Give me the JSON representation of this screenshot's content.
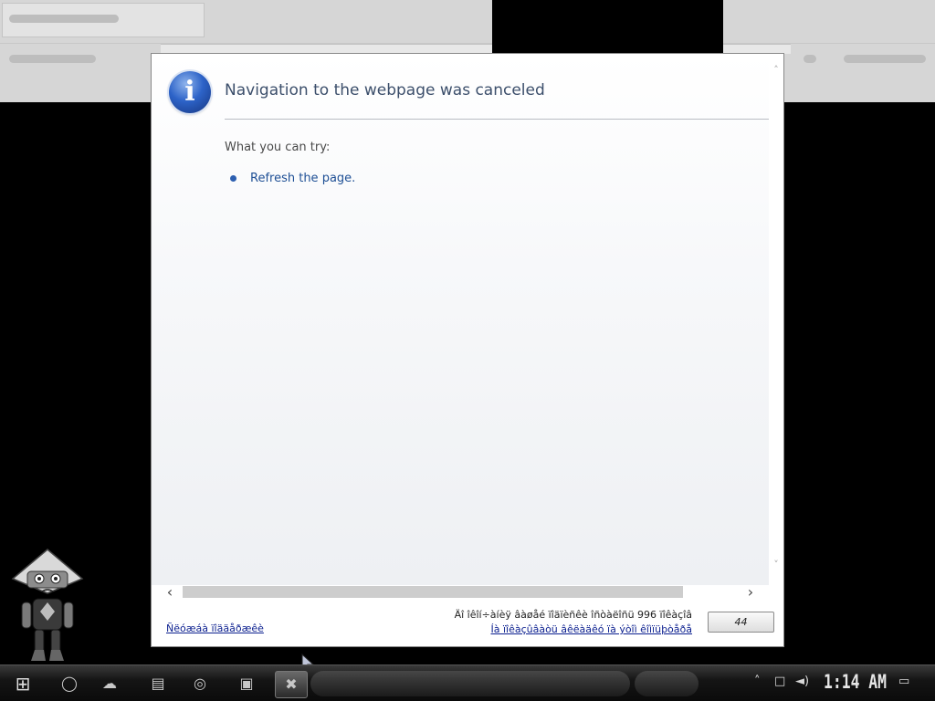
{
  "dialog": {
    "title": "Navigation to the webpage was canceled",
    "try_label": "What you can try:",
    "actions": [
      {
        "label": "Refresh the page."
      }
    ]
  },
  "status": {
    "left_link": "Ñëóæáà ïîääåðæêè",
    "text_line": "Äî îêîí÷àíèÿ âàøåé ïîäïèñêè îñòàëîñü 996 ïîêàçîâ",
    "link_line": "Íà ïîêàçûâàòü âêëàäêó ïà ýòîì êîìïüþòåðå",
    "count_button": "44"
  },
  "taskbar": {
    "clock": "1:14 AM",
    "icons": [
      "windows-start-icon",
      "circle-app-icon",
      "cloud-app-icon",
      "save-app-icon",
      "globe-app-icon",
      "puzzle-app-icon",
      "shield-x-app-icon"
    ],
    "tray_icons": [
      "chevron-up-icon",
      "network-icon",
      "volume-icon",
      "action-center-icon"
    ]
  },
  "colors": {
    "accent": "#2d63c8",
    "link": "#1e4f95",
    "title": "#3c4f6b"
  }
}
